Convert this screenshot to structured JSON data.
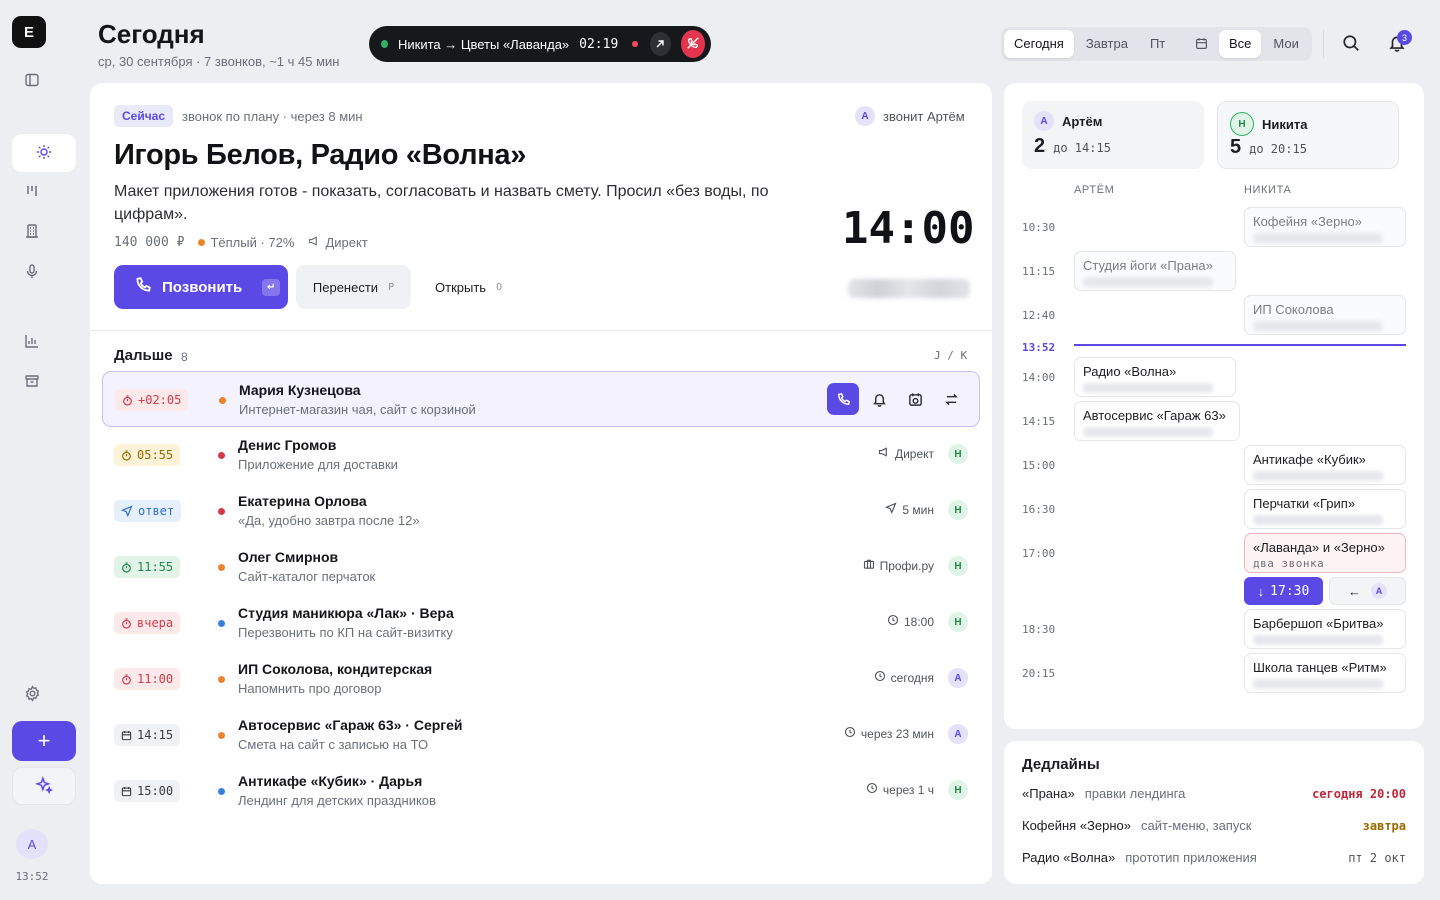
{
  "rail": {
    "logo": "E",
    "avatar": "А",
    "time": "13:52"
  },
  "header": {
    "title": "Сегодня",
    "subtitle": "ср, 30 сентября · 7 звонков, ~1 ч 45 мин",
    "call": {
      "name": "Никита → Цветы «Лаванда»",
      "timer": "02:19"
    },
    "day_tabs": [
      "Сегодня",
      "Завтра",
      "Пт"
    ],
    "scope_tabs": [
      "Все",
      "Мои"
    ],
    "notifications": "3"
  },
  "current": {
    "badge": "Сейчас",
    "meta": "звонок по плану · через 8 мин",
    "caller_avatar": "А",
    "caller": "звонит Артём",
    "title": "Игорь Белов, Радио «Волна»",
    "description": "Макет приложения готов - показать, согласовать и назвать смету. Просил «без воды, по цифрам».",
    "amount": "140 000 ₽",
    "temperature": "Тёплый · 72%",
    "source": "Директ",
    "time": "14:00",
    "call_label": "Позвонить",
    "call_key": "↵",
    "reschedule_label": "Перенести",
    "reschedule_key": "P",
    "open_label": "Открыть",
    "open_key": "O"
  },
  "queue": {
    "title": "Дальше",
    "count": "8",
    "nav_hint": "J / K",
    "items": [
      {
        "tag": "+02:05",
        "tag_style": "t-red",
        "dot": "#e8842a",
        "title": "Мария Кузнецова",
        "sub": "Интернет-магазин чая, сайт с корзиной",
        "right": "",
        "avatar": ""
      },
      {
        "tag": "05:55",
        "tag_style": "t-yel",
        "dot": "#d33a4a",
        "title": "Денис Громов",
        "sub": "Приложение для доставки",
        "right": "Директ",
        "avatar": "Н"
      },
      {
        "tag": "ответ",
        "tag_style": "t-blue",
        "dot": "#d33a4a",
        "title": "Екатерина Орлова",
        "sub": "«Да, удобно завтра после 12»",
        "right": "5 мин",
        "avatar": "Н"
      },
      {
        "tag": "11:55",
        "tag_style": "t-green",
        "dot": "#e8842a",
        "title": "Олег Смирнов",
        "sub": "Сайт-каталог перчаток",
        "right": "Профи.ру",
        "avatar": "Н"
      },
      {
        "tag": "вчера",
        "tag_style": "t-red",
        "dot": "#3b82d6",
        "title": "Студия маникюра «Лак» · Вера",
        "sub": "Перезвонить по КП на сайт-визитку",
        "right": "18:00",
        "avatar": "Н"
      },
      {
        "tag": "11:00",
        "tag_style": "t-red",
        "dot": "#e8842a",
        "title": "ИП Соколова, кондитерская",
        "sub": "Напомнить про договор",
        "right": "сегодня",
        "avatar": "А"
      },
      {
        "tag": "14:15",
        "tag_style": "t-gray",
        "dot": "#e8842a",
        "title": "Автосервис «Гараж 63» · Сергей",
        "sub": "Смета на сайт с записью на ТО",
        "right": "через 23 мин",
        "avatar": "А"
      },
      {
        "tag": "15:00",
        "tag_style": "t-gray",
        "dot": "#3b82d6",
        "title": "Антикафе «Кубик» · Дарья",
        "sub": "Лендинг для детских праздников",
        "right": "через 1 ч",
        "avatar": "Н"
      }
    ]
  },
  "schedule": {
    "people": [
      {
        "avatar": "А",
        "name": "Артём",
        "count": "2",
        "until": "до 14:15"
      },
      {
        "avatar": "Н",
        "name": "Никита",
        "count": "5",
        "until": "до 20:15"
      }
    ],
    "col_artem": "АРТЁМ",
    "col_nikita": "НИКИТА",
    "now": "13:52",
    "times": [
      "10:30",
      "11:15",
      "12:40",
      "14:00",
      "14:15",
      "15:00",
      "16:30",
      "17:00",
      "18:30",
      "20:15"
    ],
    "events": {
      "zerno": "Кофейня «Зерно»",
      "prana": "Студия йоги «Прана»",
      "sokolova": "ИП Соколова",
      "volna": "Радио «Волна»",
      "garage": "Автосервис «Гараж 63»",
      "kubik": "Антикафе «Кубик»",
      "grip": "Перчатки «Грип»",
      "lavanda": "«Лаванда» и «Зерно»",
      "lavanda_sub": "два звонка",
      "move": "17:30",
      "britva": "Барбершоп «Бритва»",
      "ritm": "Школа танцев «Ритм»"
    },
    "move_avatar": "А"
  },
  "deadlines": {
    "title": "Дедлайны",
    "items": [
      {
        "name": "«Прана»",
        "desc": "правки лендинга",
        "when": "сегодня 20:00",
        "color": "#c0263a"
      },
      {
        "name": "Кофейня «Зерно»",
        "desc": "сайт-меню, запуск",
        "when": "завтра",
        "color": "#9a6a00"
      },
      {
        "name": "Радио «Волна»",
        "desc": "прототип приложения",
        "when": "пт 2 окт",
        "color": "#50535c"
      }
    ]
  }
}
